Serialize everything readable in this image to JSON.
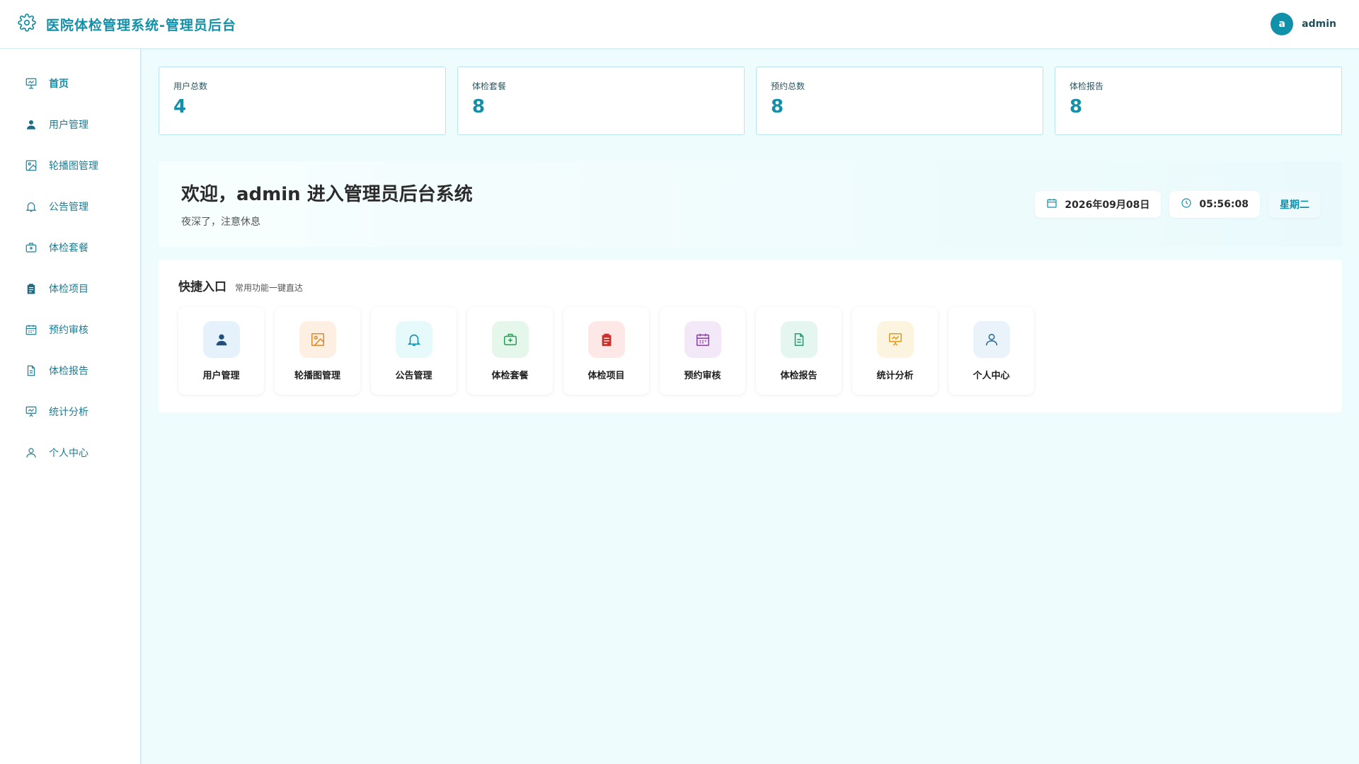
{
  "header": {
    "title": "医院体检管理系统-管理员后台",
    "avatar_letter": "a",
    "username": "admin",
    "logo_icon": "gear-icon",
    "brand_color": "#1390a8"
  },
  "sidebar": {
    "items": [
      {
        "label": "首页",
        "icon": "presentation-icon",
        "active": true
      },
      {
        "label": "用户管理",
        "icon": "user-filled-icon"
      },
      {
        "label": "轮播图管理",
        "icon": "image-icon"
      },
      {
        "label": "公告管理",
        "icon": "bell-icon"
      },
      {
        "label": "体检套餐",
        "icon": "medical-kit-icon"
      },
      {
        "label": "体检项目",
        "icon": "clipboard-icon"
      },
      {
        "label": "预约审核",
        "icon": "calendar-icon"
      },
      {
        "label": "体检报告",
        "icon": "document-icon"
      },
      {
        "label": "统计分析",
        "icon": "chart-board-icon"
      },
      {
        "label": "个人中心",
        "icon": "user-outline-icon"
      }
    ]
  },
  "stats": [
    {
      "label": "用户总数",
      "value": "4"
    },
    {
      "label": "体检套餐",
      "value": "8"
    },
    {
      "label": "预约总数",
      "value": "8"
    },
    {
      "label": "体检报告",
      "value": "8"
    }
  ],
  "welcome": {
    "title": "欢迎，admin 进入管理员后台系统",
    "subtitle": "夜深了，注意休息",
    "date": "2026年09月08日",
    "time": "05:56:08",
    "weekday": "星期二"
  },
  "quick": {
    "title": "快捷入口",
    "subtitle": "常用功能一键直达",
    "items": [
      {
        "label": "用户管理",
        "icon": "user-filled-icon",
        "bg": "#e6f2fb",
        "fg": "#1f4f7a"
      },
      {
        "label": "轮播图管理",
        "icon": "image-icon",
        "bg": "#fdf0e2",
        "fg": "#e08a2e"
      },
      {
        "label": "公告管理",
        "icon": "bell-icon",
        "bg": "#e6f9fb",
        "fg": "#1390a8"
      },
      {
        "label": "体检套餐",
        "icon": "medical-kit-icon",
        "bg": "#e5f6ea",
        "fg": "#27a35a"
      },
      {
        "label": "体检项目",
        "icon": "clipboard-icon",
        "bg": "#fde7e7",
        "fg": "#c9302c"
      },
      {
        "label": "预约审核",
        "icon": "calendar-icon",
        "bg": "#f3e8f8",
        "fg": "#8e44ad"
      },
      {
        "label": "体检报告",
        "icon": "document-icon",
        "bg": "#e5f5ef",
        "fg": "#2a9d78"
      },
      {
        "label": "统计分析",
        "icon": "chart-board-icon",
        "bg": "#fdf4e0",
        "fg": "#e09a1e"
      },
      {
        "label": "个人中心",
        "icon": "user-outline-icon",
        "bg": "#eaf2fa",
        "fg": "#2b6b9a"
      }
    ]
  }
}
